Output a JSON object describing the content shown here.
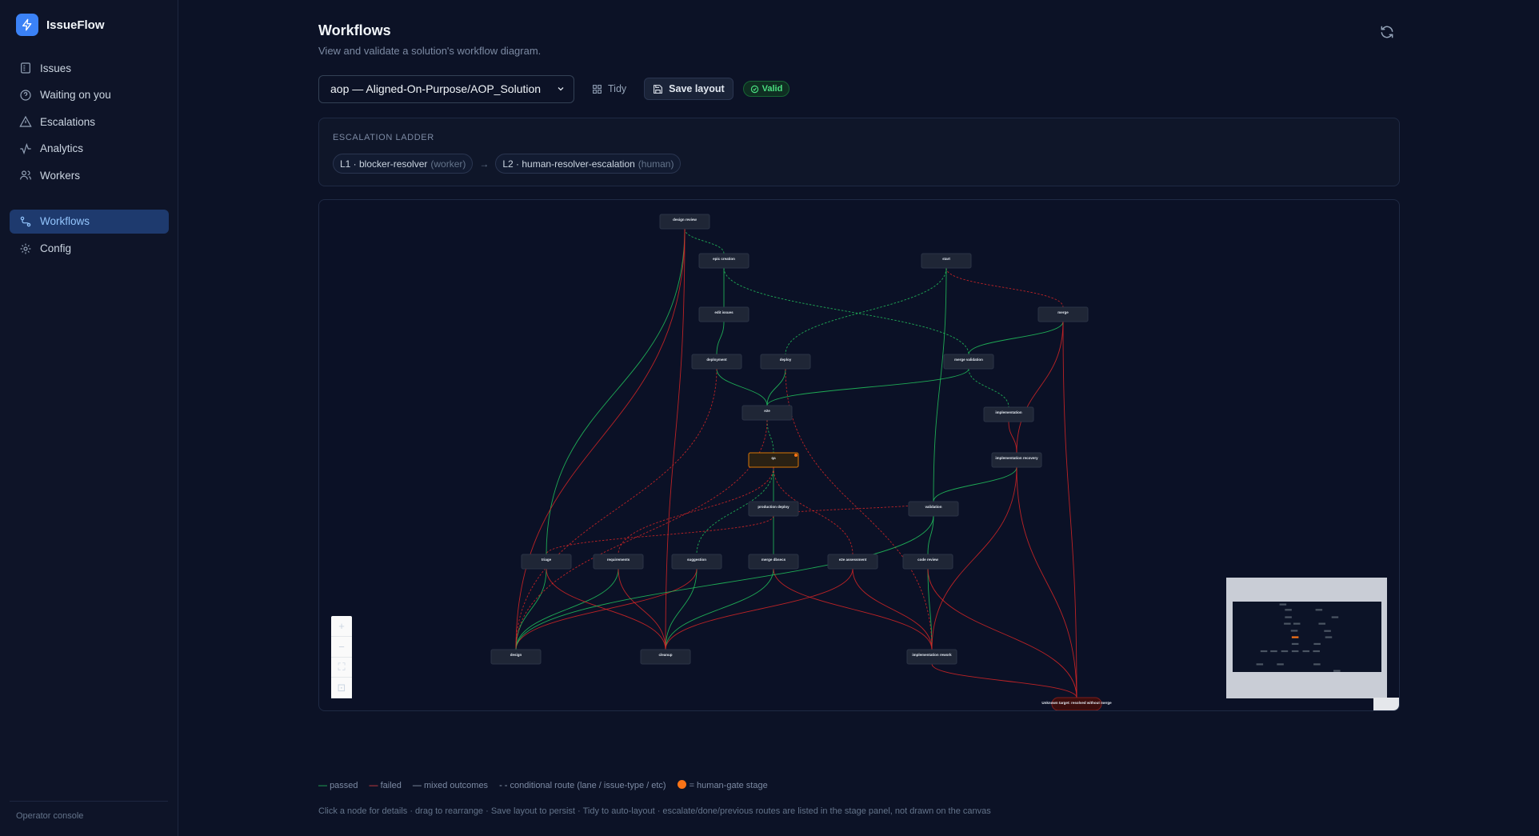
{
  "brand": {
    "name": "IssueFlow"
  },
  "nav": {
    "items": [
      {
        "label": "Issues",
        "icon": "list-icon"
      },
      {
        "label": "Waiting on you",
        "icon": "help-circle-icon"
      },
      {
        "label": "Escalations",
        "icon": "warning-icon"
      },
      {
        "label": "Analytics",
        "icon": "activity-icon"
      },
      {
        "label": "Workers",
        "icon": "users-icon"
      },
      {
        "label": "Workflows",
        "icon": "workflow-icon",
        "active": true
      },
      {
        "label": "Config",
        "icon": "gear-icon"
      }
    ],
    "footer": "Operator console"
  },
  "header": {
    "title": "Workflows",
    "subtitle": "View and validate a solution's workflow diagram."
  },
  "toolbar": {
    "selected_solution": "aop — Aligned-On-Purpose/AOP_Solution",
    "tidy_label": "Tidy",
    "save_label": "Save layout",
    "status_label": "Valid"
  },
  "ladder": {
    "title": "ESCALATION LADDER",
    "steps": [
      {
        "label": "L1 · blocker-resolver",
        "kind": "(worker)"
      },
      {
        "label": "L2 · human-resolver-escalation",
        "kind": "(human)"
      }
    ],
    "separator": "→"
  },
  "graph": {
    "nodes": [
      {
        "id": "design-review",
        "label": "design review"
      },
      {
        "id": "epic-creation",
        "label": "epic creation"
      },
      {
        "id": "start",
        "label": "start"
      },
      {
        "id": "edit-issues",
        "label": "edit issues"
      },
      {
        "id": "merge",
        "label": "merge"
      },
      {
        "id": "deployment",
        "label": "deployment"
      },
      {
        "id": "deploy",
        "label": "deploy"
      },
      {
        "id": "merge-validation",
        "label": "merge validation"
      },
      {
        "id": "e2e",
        "label": "e2e"
      },
      {
        "id": "implementation",
        "label": "implementation"
      },
      {
        "id": "qa",
        "label": "qa",
        "human_gate": true
      },
      {
        "id": "implementation-recovery",
        "label": "implementation recovery"
      },
      {
        "id": "production-deploy",
        "label": "production deploy"
      },
      {
        "id": "validation",
        "label": "validation"
      },
      {
        "id": "triage",
        "label": "triage"
      },
      {
        "id": "requirements",
        "label": "requirements"
      },
      {
        "id": "suggestion",
        "label": "suggestion"
      },
      {
        "id": "merge-dbsecs",
        "label": "merge dbsecs"
      },
      {
        "id": "e2e-assessment",
        "label": "e2e assessment"
      },
      {
        "id": "code-review",
        "label": "code review"
      },
      {
        "id": "design",
        "label": "design"
      },
      {
        "id": "cleanup",
        "label": "cleanup"
      },
      {
        "id": "implementation-rework",
        "label": "implementation rework"
      },
      {
        "id": "unknown-target",
        "label": "Unknown target: resolved without merge"
      }
    ]
  },
  "legend": {
    "passed": "passed",
    "failed": "failed",
    "mixed": "mixed outcomes",
    "conditional": "conditional route (lane / issue-type / etc)",
    "human_gate": "= human-gate stage",
    "colors": {
      "passed": "#22c55e",
      "failed": "#ef4444",
      "mixed": "#94a3b8",
      "human_gate": "#f97316"
    }
  },
  "hint": "Click a node for details · drag to rearrange · Save layout to persist · Tidy to auto-layout · escalate/done/previous routes are listed in the stage panel, not drawn on the canvas"
}
